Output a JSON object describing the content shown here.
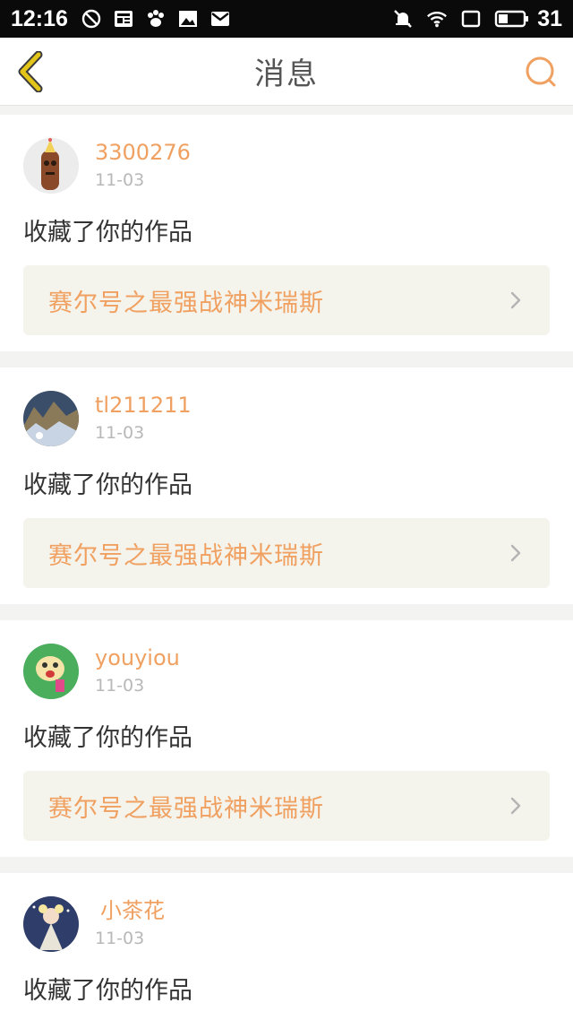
{
  "status_bar": {
    "time": "12:16",
    "battery": "31",
    "icons_left": [
      "alarm-off-icon",
      "news-icon",
      "paw-icon",
      "image-icon",
      "mail-icon"
    ],
    "icons_right": [
      "bell-muted-icon",
      "wifi-icon",
      "square-icon",
      "battery-icon"
    ]
  },
  "navbar": {
    "title": "消息",
    "back_icon": "chevron-left-icon",
    "search_icon": "search-icon",
    "accent": "#f0a060",
    "back_color": "#e3c51a"
  },
  "messages": [
    {
      "username": "3300276",
      "date": "11-03",
      "action": "收藏了你的作品",
      "work_title": "赛尔号之最强战神米瑞斯"
    },
    {
      "username": "tl211211",
      "date": "11-03",
      "action": "收藏了你的作品",
      "work_title": "赛尔号之最强战神米瑞斯"
    },
    {
      "username": "youyiou",
      "date": "11-03",
      "action": "收藏了你的作品",
      "work_title": "赛尔号之最强战神米瑞斯"
    },
    {
      "username": " 小茶花 ",
      "date": "11-03",
      "action": "收藏了你的作品",
      "work_title": ""
    }
  ]
}
